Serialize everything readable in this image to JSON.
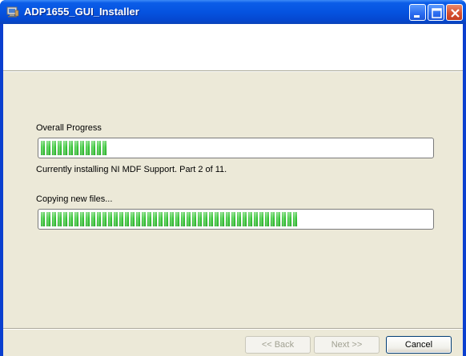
{
  "window": {
    "title": "ADP1655_GUI_Installer",
    "controls": [
      "minimize-icon",
      "maximize-icon",
      "close-icon"
    ]
  },
  "overall": {
    "label": "Overall Progress",
    "progress": 0.17,
    "status": "Currently installing NI MDF Support.  Part 2 of 11."
  },
  "current": {
    "label": "Copying new files...",
    "progress": 0.66
  },
  "buttons": {
    "back": "<< Back",
    "next": "Next >>",
    "cancel": "Cancel"
  },
  "colors": {
    "titlebar": "#0553e0",
    "progress_green": "#2fbe2f",
    "background": "#ece9d8"
  }
}
